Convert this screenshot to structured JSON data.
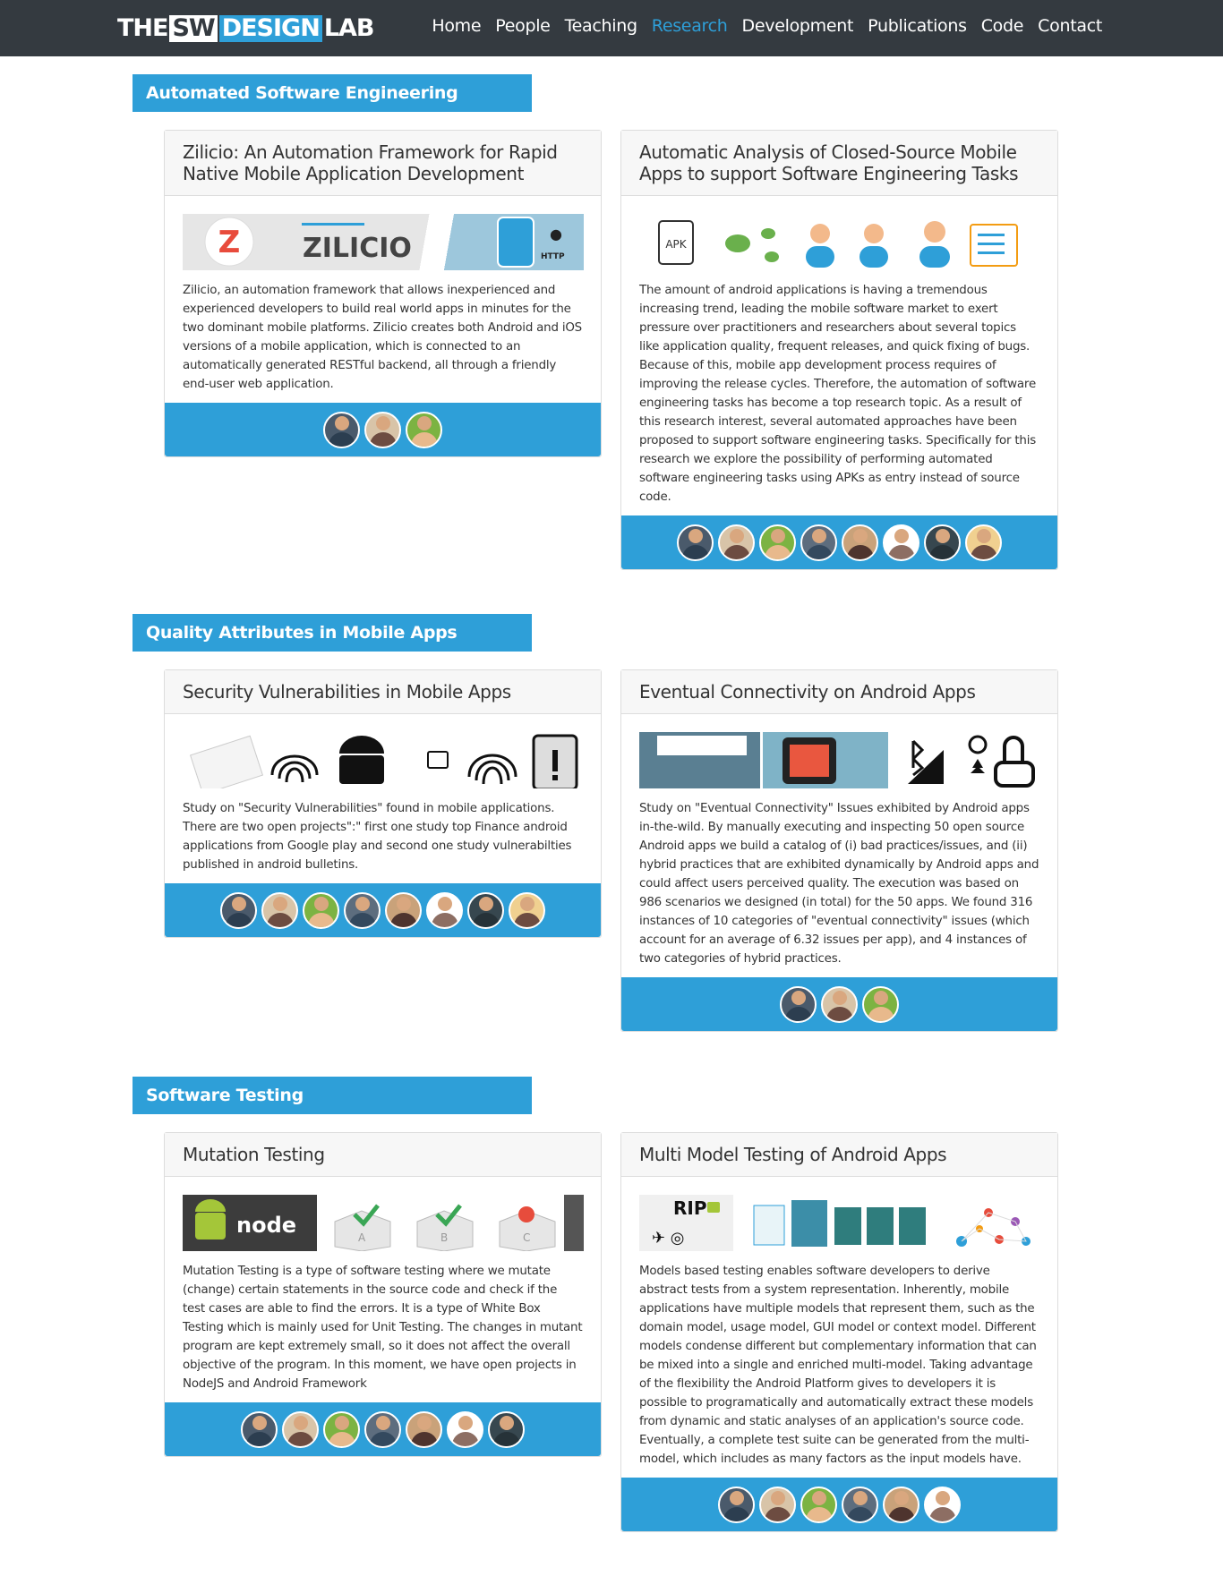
{
  "nav": {
    "logo": {
      "the": "THE",
      "sw": "SW",
      "design": "DESIGN",
      "lab": "LAB"
    },
    "items": [
      "Home",
      "People",
      "Teaching",
      "Research",
      "Development",
      "Publications",
      "Code",
      "Contact"
    ],
    "active": "Research"
  },
  "sections": [
    {
      "title": "Automated Software Engineering",
      "cards": [
        {
          "title": "Zilicio: An Automation Framework for Rapid Native Mobile Application Development",
          "banner_text": "ZILICIO",
          "banner_small": "HTTP",
          "text": "Zilicio, an automation framework that allows inexperienced and experienced developers to build real world apps in minutes for the two dominant mobile platforms. Zilicio creates both Android and iOS versions of a mobile application, which is connected to an automatically generated RESTful backend, all through a friendly end-user web application.",
          "avatars": 3
        },
        {
          "title": "Automatic Analysis of Closed-Source Mobile Apps to support Software Engineering Tasks",
          "banner_text": "APK",
          "text": "The amount of android applications is having a tremendous increasing trend, leading the mobile software market to exert pressure over practitioners and researchers about several topics like application quality, frequent releases, and quick fixing of bugs. Because of this, mobile app development process requires of improving the release cycles. Therefore, the automation of software engineering tasks has become a top research topic. As a result of this research interest, several automated approaches have been proposed to support software engineering tasks. Specifically for this research we explore the possibility of performing automated software engineering tasks using APKs as entry instead of source code.",
          "avatars": 8
        }
      ]
    },
    {
      "title": "Quality Attributes in Mobile Apps",
      "cards": [
        {
          "title": "Security Vulnerabilities in Mobile Apps",
          "text": "Study on \"Security Vulnerabilities\" found in mobile applications. There are two open projects\":\" first one study top Finance android applications from Google play and second one study vulnerabilties published in android bulletins.",
          "avatars": 8
        },
        {
          "title": "Eventual Connectivity on Android Apps",
          "text": "Study on \"Eventual Connectivity\" Issues exhibited by Android apps in-the-wild. By manually executing and inspecting 50 open source Android apps we build a catalog of (i) bad practices/issues, and (ii) hybrid practices that are exhibited dynamically by Android apps and could affect users perceived quality. The execution was based on 986 scenarios we designed (in total) for the 50 apps. We found 316 instances of 10 categories of \"eventual connectivity\" issues (which account for an average of 6.32 issues per app), and 4 instances of two categories of hybrid practices.",
          "avatars": 3
        }
      ]
    },
    {
      "title": "Software Testing",
      "cards": [
        {
          "title": "Mutation Testing",
          "banner_labels": [
            "A",
            "B",
            "C"
          ],
          "text": "Mutation Testing is a type of software testing where we mutate (change) certain statements in the source code and check if the test cases are able to find the errors. It is a type of White Box Testing which is mainly used for Unit Testing. The changes in mutant program are kept extremely small, so it does not affect the overall objective of the program. In this moment, we have open projects in NodeJS and Android Framework",
          "avatars": 7
        },
        {
          "title": "Multi Model Testing of Android Apps",
          "banner_text": "RIP",
          "text": "Models based testing enables software developers to derive abstract tests from a system representation. Inherently, mobile applications have multiple models that represent them, such as the domain model, usage model, GUI model or context model. Different models condense different but complementary information that can be mixed into a single and enriched multi-model. Taking advantage of the flexibility the Android Platform gives to developers it is possible to programatically and automatically extract these models from dynamic and static analyses of an application's source code. Eventually, a complete test suite can be generated from the multi-model, which includes as many factors as the input models have.",
          "avatars": 6
        }
      ]
    }
  ],
  "colors": {
    "accent": "#2e9fd8",
    "navbar": "#343a40"
  }
}
